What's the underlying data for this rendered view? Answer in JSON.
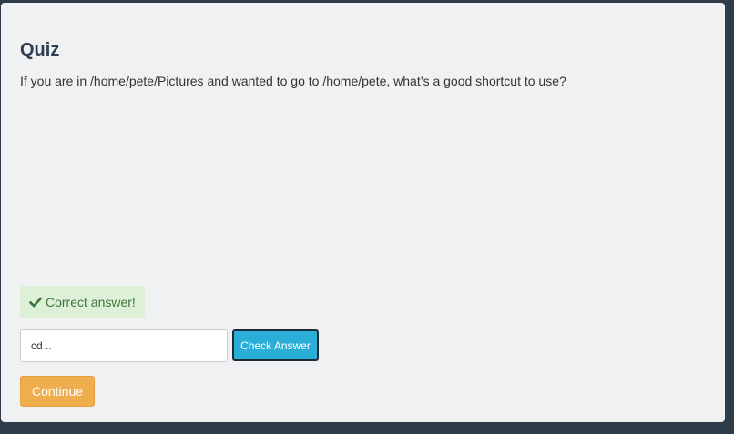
{
  "quiz": {
    "title": "Quiz",
    "question": "If you are in /home/pete/Pictures and wanted to go to /home/pete, what’s a good shortcut to use?"
  },
  "feedback": {
    "icon": "check-icon",
    "text": "Correct answer!",
    "color": "#3c763d",
    "background": "#dff0d8"
  },
  "answer": {
    "value": "cd .."
  },
  "buttons": {
    "check_label": "Check Answer",
    "continue_label": "Continue"
  },
  "colors": {
    "page_background": "#2f3d4a",
    "card_background": "#f0f1f3",
    "check_button": "#2aaed8",
    "continue_button": "#f0ad4e"
  }
}
